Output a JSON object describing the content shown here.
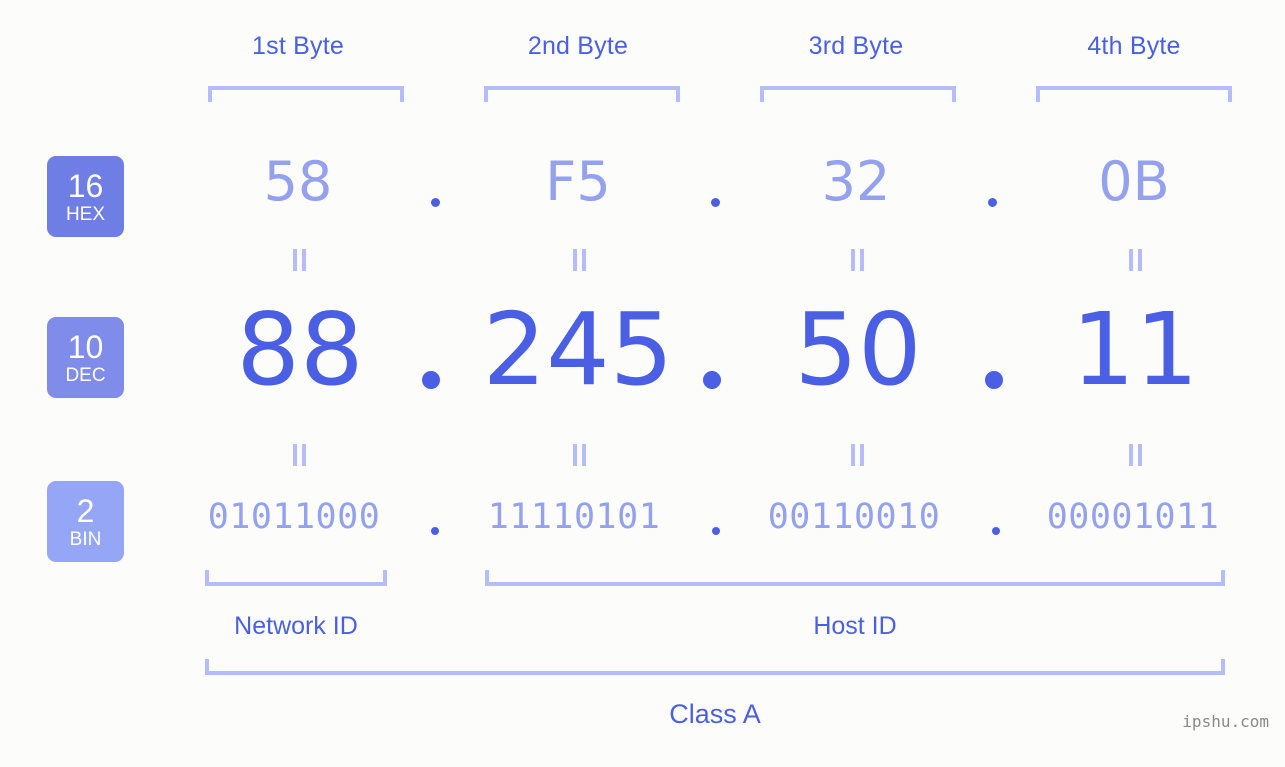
{
  "background_color": "#fcfdfa",
  "accent_color": "#4a5fe3",
  "light_accent_color": "#93a1ee",
  "bracket_color": "#b4bdf7",
  "badge_hex_color": "#6f7ee4",
  "badge_dec_color": "#7f8cea",
  "badge_bin_color": "#94a6f5",
  "header": {
    "bytes": [
      {
        "label": "1st Byte"
      },
      {
        "label": "2nd Byte"
      },
      {
        "label": "3rd Byte"
      },
      {
        "label": "4th Byte"
      }
    ]
  },
  "rows": [
    {
      "badge_number": "16",
      "badge_name": "HEX",
      "values": [
        "58",
        "F5",
        "32",
        "0B"
      ],
      "separator": "."
    },
    {
      "badge_number": "10",
      "badge_name": "DEC",
      "values": [
        "88",
        "245",
        "50",
        "11"
      ],
      "separator": "."
    },
    {
      "badge_number": "2",
      "badge_name": "BIN",
      "values": [
        "01011000",
        "11110101",
        "00110010",
        "00001011"
      ],
      "separator": "."
    }
  ],
  "connector_symbol": "=",
  "sections": {
    "network_id": "Network ID",
    "host_id": "Host ID"
  },
  "class_label": "Class A",
  "watermark": "ipshu.com"
}
